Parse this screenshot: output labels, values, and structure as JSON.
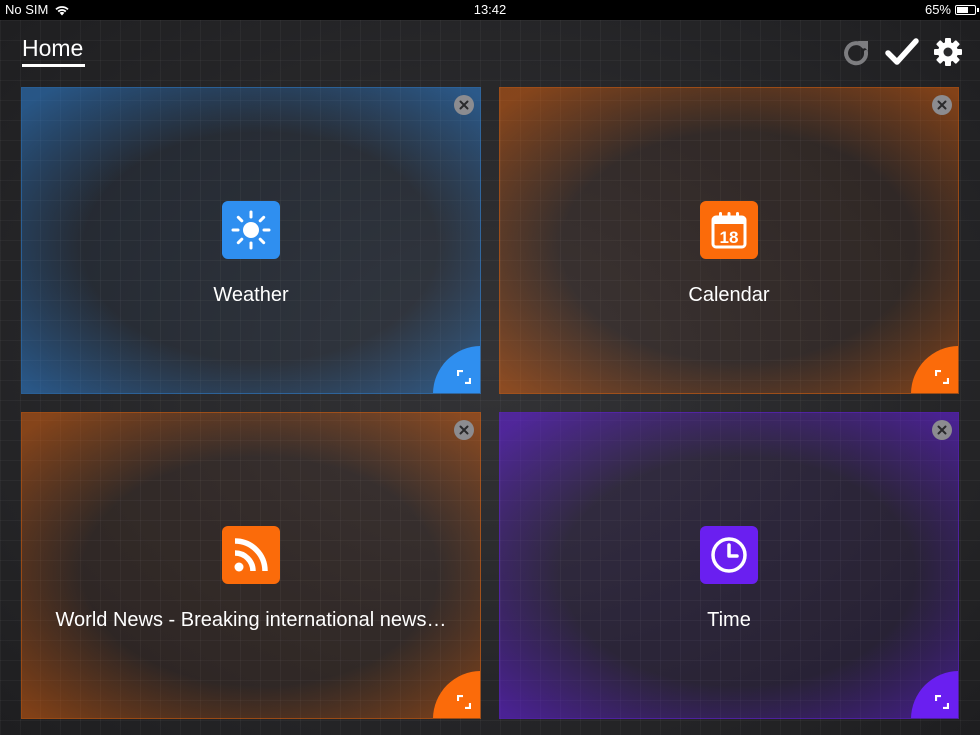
{
  "status": {
    "carrier": "No SIM",
    "time": "13:42",
    "battery": "65%",
    "battery_level": 0.65
  },
  "header": {
    "title": "Home"
  },
  "colors": {
    "blue": "#2f8ff0",
    "orange": "#fb6b0a",
    "purple": "#6a1ff0"
  },
  "tiles": [
    {
      "label": "Weather",
      "icon": "sun-icon",
      "color": "#2f8ff0"
    },
    {
      "label": "Calendar",
      "icon": "calendar-icon",
      "day": "18",
      "color": "#fb6b0a"
    },
    {
      "label": "World News - Breaking international news…",
      "icon": "rss-icon",
      "color": "#fb6b0a"
    },
    {
      "label": "Time",
      "icon": "clock-icon",
      "color": "#6a1ff0"
    }
  ]
}
